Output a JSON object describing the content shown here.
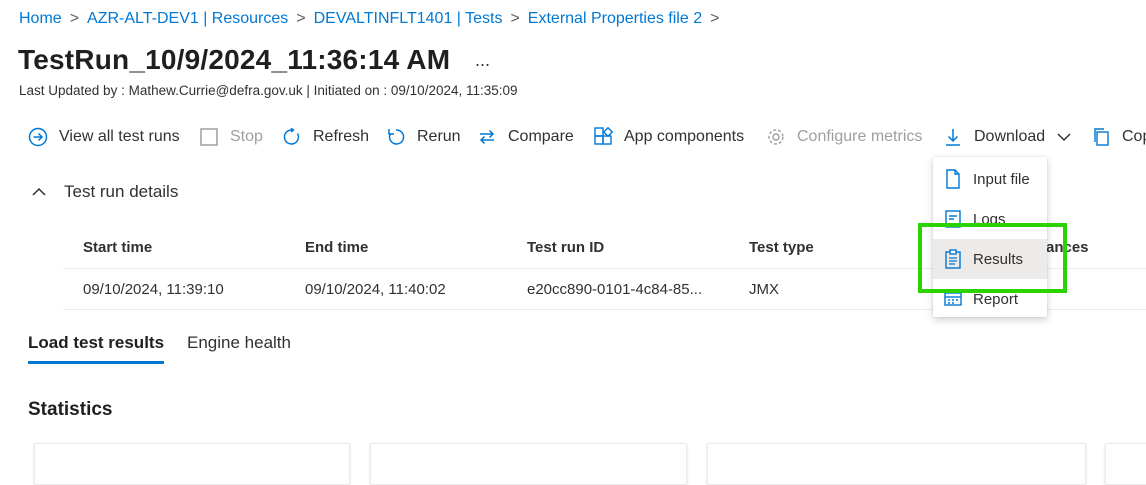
{
  "breadcrumb": {
    "items": [
      "Home",
      "AZR-ALT-DEV1 | Resources",
      "DEVALTINFLT1401 | Tests",
      "External Properties file 2"
    ],
    "separator": ">"
  },
  "page": {
    "title": "TestRun_10/9/2024_11:36:14 AM",
    "more": "...",
    "subline": "Last Updated by : Mathew.Currie@defra.gov.uk | Initiated on : 09/10/2024, 11:35:09"
  },
  "toolbar": {
    "view_all": "View all test runs",
    "stop": "Stop",
    "refresh": "Refresh",
    "rerun": "Rerun",
    "compare": "Compare",
    "app_components": "App components",
    "configure_metrics": "Configure metrics",
    "download": "Download",
    "copy": "Cop"
  },
  "details": {
    "toggle_label": "Test run details",
    "columns": [
      "Start time",
      "End time",
      "Test run ID",
      "Test type",
      "tances"
    ],
    "row": [
      "09/10/2024, 11:39:10",
      "09/10/2024, 11:40:02",
      "e20cc890-0101-4c84-85...",
      "JMX"
    ]
  },
  "tabs": [
    "Load test results",
    "Engine health"
  ],
  "statistics": {
    "heading": "Statistics"
  },
  "download_menu": {
    "items": [
      {
        "label": "Input file",
        "icon": "file-icon"
      },
      {
        "label": "Logs",
        "icon": "logs-icon"
      },
      {
        "label": "Results",
        "icon": "clipboard-icon"
      },
      {
        "label": "Report",
        "icon": "report-icon"
      }
    ]
  },
  "colors": {
    "accent": "#0078d4",
    "highlight": "#2bd400",
    "disabled": "#a19f9d"
  }
}
